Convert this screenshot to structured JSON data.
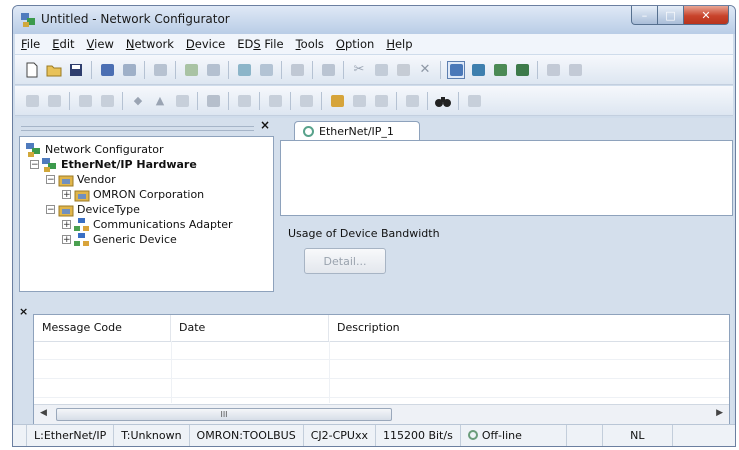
{
  "window": {
    "title": "Untitled - Network Configurator"
  },
  "menu": [
    {
      "pre": "",
      "acc": "F",
      "post": "ile"
    },
    {
      "pre": "",
      "acc": "E",
      "post": "dit"
    },
    {
      "pre": "",
      "acc": "V",
      "post": "iew"
    },
    {
      "pre": "",
      "acc": "N",
      "post": "etwork"
    },
    {
      "pre": "",
      "acc": "D",
      "post": "evice"
    },
    {
      "pre": "ED",
      "acc": "S",
      "post": " File"
    },
    {
      "pre": "",
      "acc": "T",
      "post": "ools"
    },
    {
      "pre": "",
      "acc": "O",
      "post": "ption"
    },
    {
      "pre": "",
      "acc": "H",
      "post": "elp"
    }
  ],
  "tree": {
    "root": "Network Configurator",
    "hardware": "EtherNet/IP Hardware",
    "vendor": "Vendor",
    "vendor_item": "OMRON Corporation",
    "device_type": "DeviceType",
    "type_item_1": "Communications Adapter",
    "type_item_2": "Generic Device"
  },
  "network_tab": {
    "label": "EtherNet/IP_1"
  },
  "bandwidth": {
    "label": "Usage of Device Bandwidth",
    "detail_button": "Detail..."
  },
  "log": {
    "columns": [
      "Message Code",
      "Date",
      "Description"
    ],
    "thumb_grip": "III"
  },
  "status": {
    "network": "L:EtherNet/IP",
    "target": "T:Unknown",
    "port": "OMRON:TOOLBUS",
    "cpu": "CJ2-CPUxx",
    "baud": "115200 Bit/s",
    "connection": "Off-line",
    "mode": "NL"
  },
  "colors": {
    "title_bar": "#c3d4ea",
    "close_button": "#c8432b",
    "tab_ring": "#58a28b"
  }
}
